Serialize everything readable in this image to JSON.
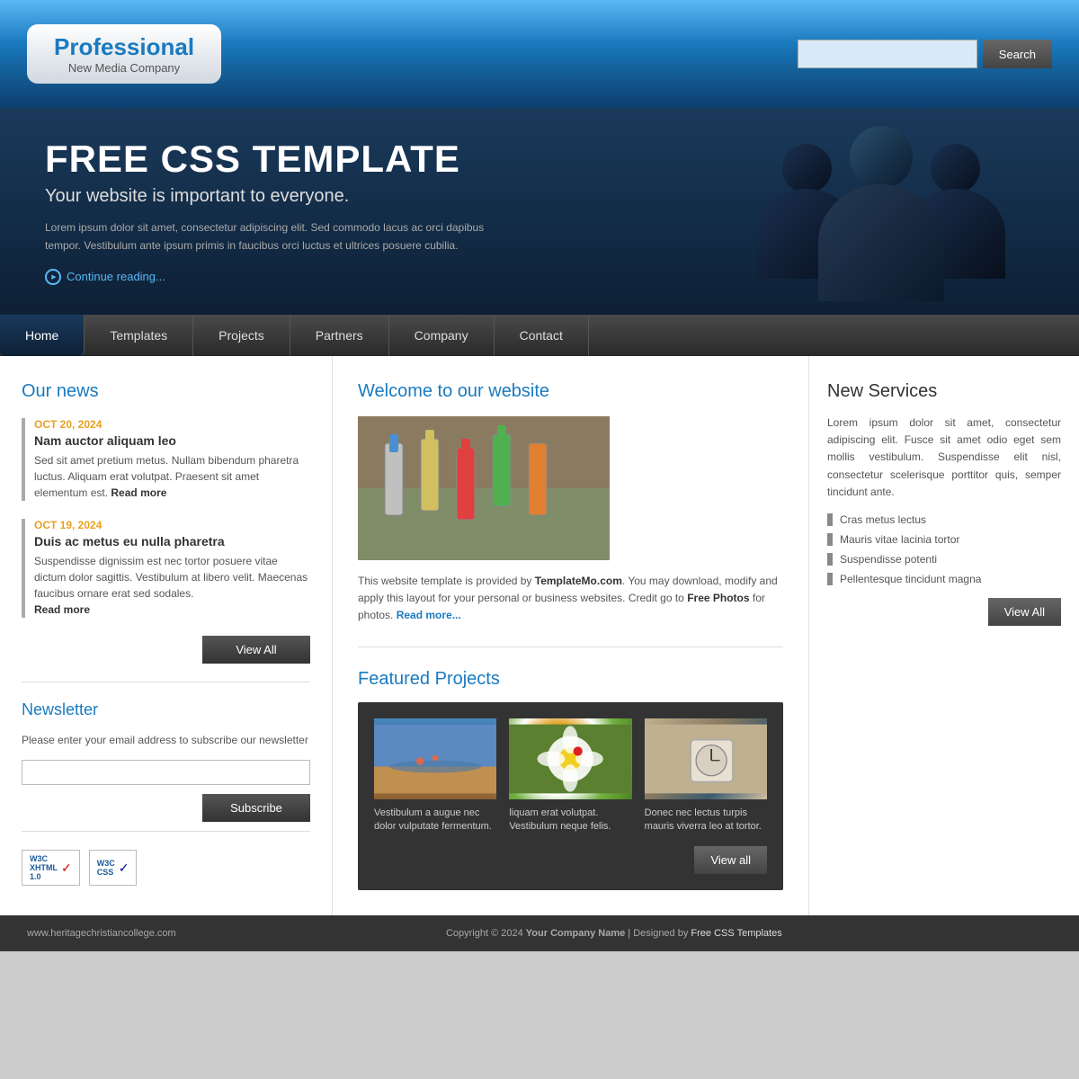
{
  "header": {
    "logo": {
      "company_name": "Professional",
      "tagline": "New Media Company"
    },
    "search": {
      "placeholder": "",
      "button_label": "Search"
    }
  },
  "nav": {
    "items": [
      {
        "label": "Home",
        "active": true
      },
      {
        "label": "Templates",
        "active": false
      },
      {
        "label": "Projects",
        "active": false
      },
      {
        "label": "Partners",
        "active": false
      },
      {
        "label": "Company",
        "active": false
      },
      {
        "label": "Contact",
        "active": false
      }
    ]
  },
  "banner": {
    "heading": "FREE CSS TEMPLATE",
    "subheading": "Your website is important to everyone.",
    "body": "Lorem ipsum dolor sit amet, consectetur adipiscing elit. Sed commodo lacus ac orci dapibus tempor. Vestibulum ante ipsum primis in faucibus orci luctus et ultrices posuere cubilia.",
    "read_more": "Continue reading..."
  },
  "sidebar": {
    "news_title": "Our news",
    "news_items": [
      {
        "date": "OCT 20, 2024",
        "title": "Nam auctor aliquam leo",
        "text": "Sed sit amet pretium metus. Nullam bibendum pharetra luctus. Aliquam erat volutpat. Praesent sit amet elementum est.",
        "read_more": "Read more"
      },
      {
        "date": "OCT 19, 2024",
        "title": "Duis ac metus eu nulla pharetra",
        "text": "Suspendisse dignissim est nec tortor posuere vitae dictum dolor sagittis. Vestibulum at libero velit. Maecenas faucibus ornare erat sed sodales.",
        "read_more": "Read more"
      }
    ],
    "view_all_label": "View All",
    "newsletter_title": "Newsletter",
    "newsletter_text": "Please enter your email address to subscribe our newsletter",
    "subscribe_label": "Subscribe",
    "badges": [
      {
        "label": "W3C XHTML 1.0"
      },
      {
        "label": "W3C CSS"
      }
    ]
  },
  "center": {
    "welcome_title": "Welcome to our website",
    "welcome_text": "This website template is provided by",
    "welcome_link1": "TemplateMo.com",
    "welcome_text2": ". You may download, modify and apply this layout for your personal or business websites. Credit go to",
    "welcome_link2": "Free Photos",
    "welcome_text3": "for photos.",
    "welcome_read_more": "Read more...",
    "projects_title": "Featured Projects",
    "projects": [
      {
        "caption": "Vestibulum a augue nec dolor vulputate fermentum."
      },
      {
        "caption": "liquam erat volutpat. Vestibulum neque felis."
      },
      {
        "caption": "Donec nec lectus turpis mauris viverra leo at tortor."
      }
    ],
    "view_all_label": "View all"
  },
  "right_sidebar": {
    "title": "New Services",
    "description": "Lorem ipsum dolor sit amet, consectetur adipiscing elit. Fusce sit amet odio eget sem mollis vestibulum. Suspendisse elit nisl, consectetur scelerisque porttitor quis, semper tincidunt ante.",
    "services": [
      "Cras metus lectus",
      "Mauris vitae lacinia tortor",
      "Suspendisse potenti",
      "Pellentesque tincidunt magna"
    ],
    "view_all_label": "View All"
  },
  "footer": {
    "left_text": "www.heritagechristiancollege.com",
    "copyright": "Copyright © 2024",
    "company_name": "Your Company Name",
    "designed_by": "| Designed by",
    "designer": "Free CSS Templates"
  }
}
